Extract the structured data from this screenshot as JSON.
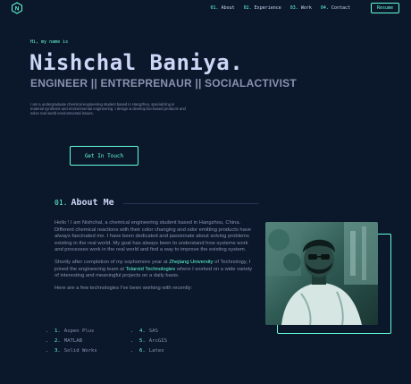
{
  "header": {
    "logo_letter": "N",
    "nav": [
      {
        "num": "01.",
        "label": "About"
      },
      {
        "num": "02.",
        "label": "Experience"
      },
      {
        "num": "03.",
        "label": "Work"
      },
      {
        "num": "04.",
        "label": "Contact"
      }
    ],
    "resume_label": "Resume"
  },
  "hero": {
    "intro": "Hi, my name is",
    "name": "Nishchal Baniya.",
    "roles": "ENGINEER || ENTREPRENAUR || SOCIALACTIVIST",
    "blurb": "I am a undergraduate chemical engineering student based in Hangzhou, specializing in material synthesis and environmental engineering. I design & develop bio-based products and solve real world environmental issues.",
    "cta_label": "Get In Touch"
  },
  "about": {
    "num": "01.",
    "title": "About Me",
    "p1": "Hello ! I am Nishchal, a chemical engineering student based in Hangzhou, China. Different chemical reactions with their color changing and odor emitting products have always fascinated me. I have been dedicated and passionate about solving problems existing in the real world. My goal has always been to understand how systems work and processes work in the real world and find a way to improve the existing system.",
    "p2_pre": "Shortly after completion of my sophomore year at ",
    "p2_link1": "Zhejiang University",
    "p2_mid": " of Technology, I joined the engineering team at ",
    "p2_link2": "Tolaroid Technologies",
    "p2_post": " where I worked on a wide variety of interesting and meaningful projects on a daily basis.",
    "p3": "Here are a few technologies I've been working with recently:",
    "techs": [
      {
        "num": "1.",
        "name": "Aspen Plus"
      },
      {
        "num": "4.",
        "name": "SAS"
      },
      {
        "num": "2.",
        "name": "MATLAB"
      },
      {
        "num": "5.",
        "name": "ArcGIS"
      },
      {
        "num": "3.",
        "name": "Solid Works"
      },
      {
        "num": "6.",
        "name": "Latex"
      }
    ]
  },
  "colors": {
    "background": "#0b172a",
    "accent": "#64ffda",
    "heading": "#ccd6f6",
    "body_text": "#8892b0"
  }
}
